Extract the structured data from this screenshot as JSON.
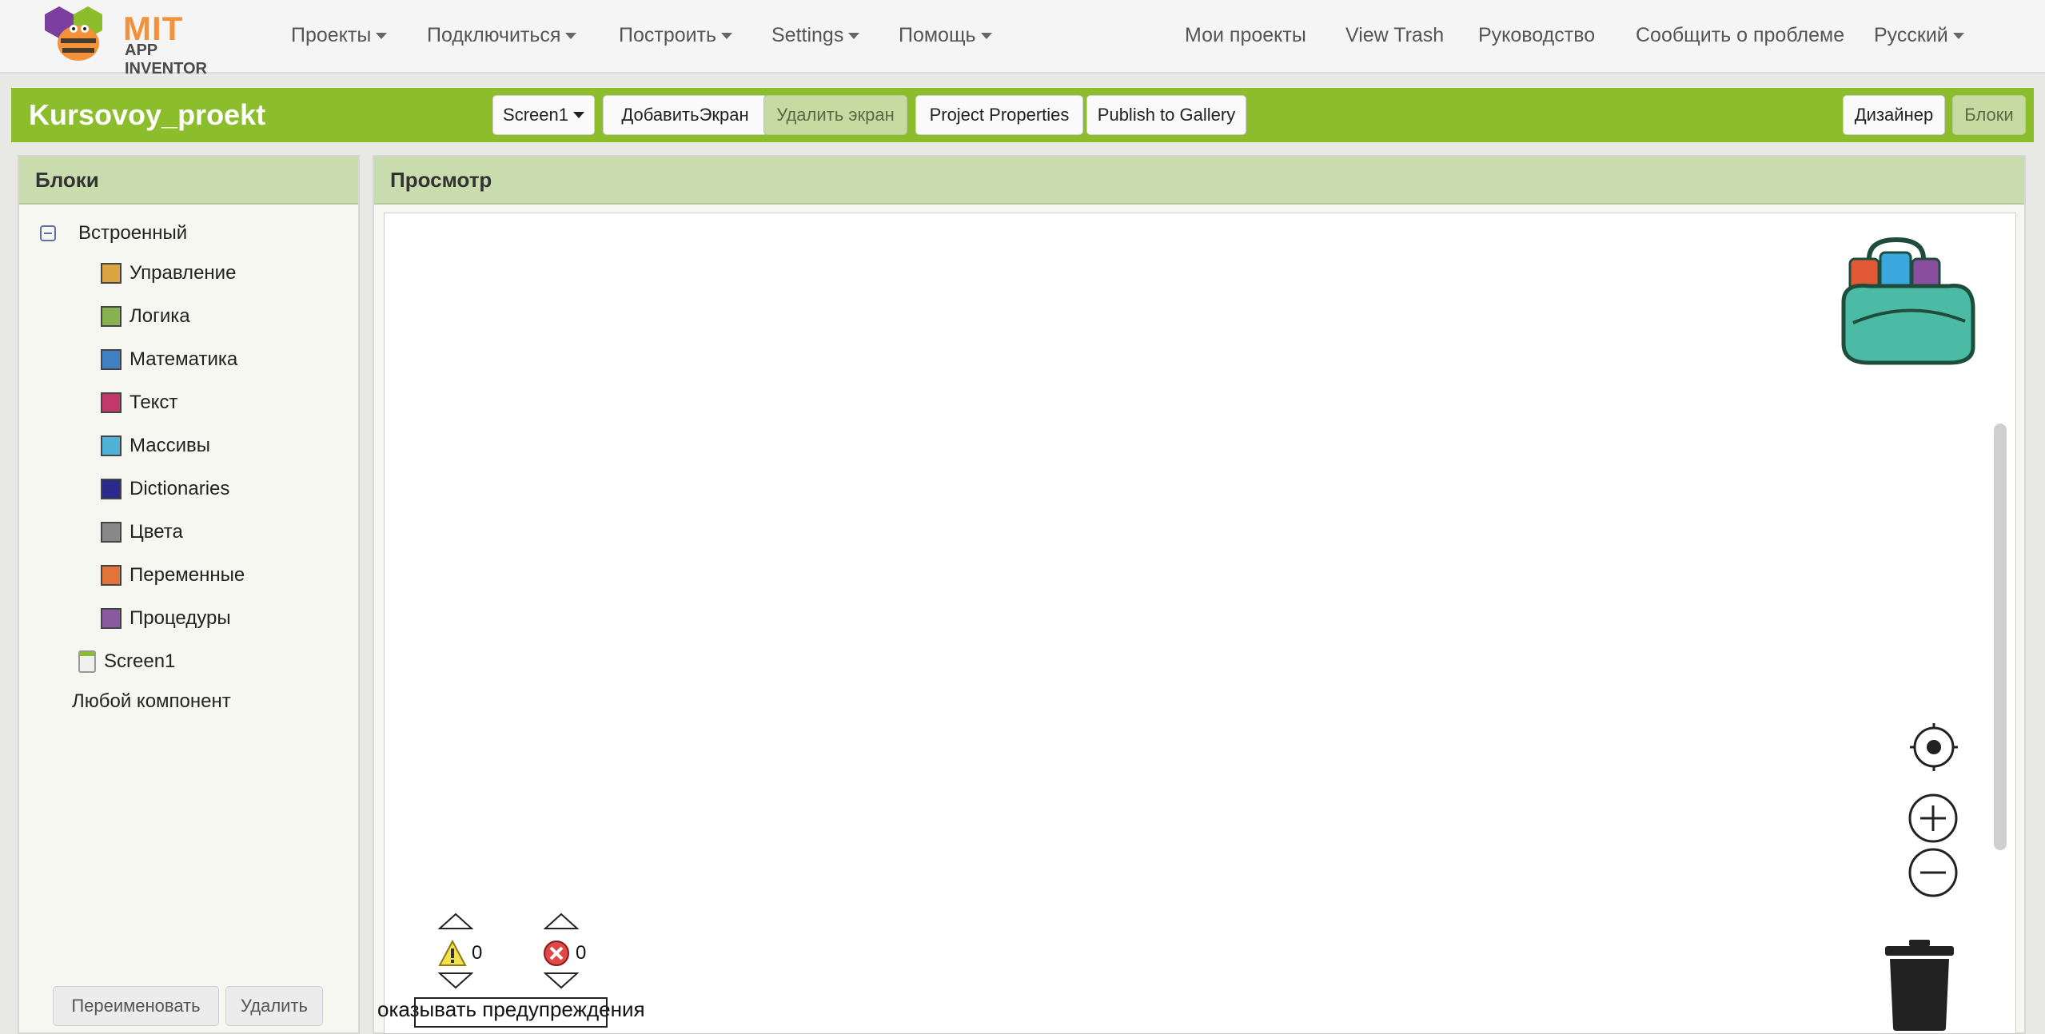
{
  "logo": {
    "mit": "MIT",
    "sub": "APP INVENTOR"
  },
  "nav": {
    "left": [
      {
        "label": "Проекты",
        "dropdown": true
      },
      {
        "label": "Подключиться",
        "dropdown": true
      },
      {
        "label": "Построить",
        "dropdown": true
      },
      {
        "label": "Settings",
        "dropdown": true
      },
      {
        "label": "Помощь",
        "dropdown": true
      }
    ],
    "right": [
      {
        "label": "Мои проекты"
      },
      {
        "label": "View Trash"
      },
      {
        "label": "Руководство"
      },
      {
        "label": "Сообщить о проблеме"
      },
      {
        "label": "Русский",
        "dropdown": true
      }
    ]
  },
  "toolbar": {
    "project_name": "Kursovoy_proekt",
    "screen_select": "Screen1",
    "add_screen": "ДобавитьЭкран",
    "remove_screen": "Удалить экран",
    "project_properties": "Project Properties",
    "publish": "Publish to Gallery",
    "designer": "Дизайнер",
    "blocks": "Блоки"
  },
  "blocks_panel": {
    "title": "Блоки",
    "builtin": "Встроенный",
    "categories": [
      {
        "label": "Управление",
        "color": "#d9a441"
      },
      {
        "label": "Логика",
        "color": "#87b250"
      },
      {
        "label": "Математика",
        "color": "#3f7fc2"
      },
      {
        "label": "Текст",
        "color": "#c2386a"
      },
      {
        "label": "Массивы",
        "color": "#4fb3d8"
      },
      {
        "label": "Dictionaries",
        "color": "#2b2a8c"
      },
      {
        "label": "Цвета",
        "color": "#888888"
      },
      {
        "label": "Переменные",
        "color": "#e2743a"
      },
      {
        "label": "Процедуры",
        "color": "#8a5aa0"
      }
    ],
    "screen": "Screen1",
    "any_component": "Любой компонент",
    "rename": "Переименовать",
    "delete": "Удалить"
  },
  "viewer": {
    "title": "Просмотр",
    "warnings_count": "0",
    "errors_count": "0",
    "show_warnings": "оказывать предупреждения"
  }
}
